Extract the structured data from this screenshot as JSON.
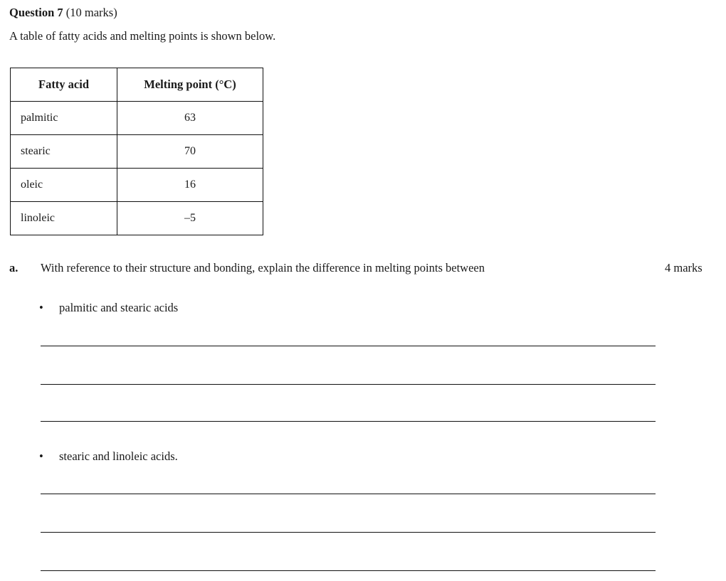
{
  "heading": {
    "question_label": "Question 7",
    "marks": " (10 marks)",
    "intro": "A table of fatty acids and melting points is shown below."
  },
  "table": {
    "headers": [
      "Fatty acid",
      "Melting point (°C)"
    ],
    "rows": [
      {
        "acid": "palmitic",
        "melting_point": "63"
      },
      {
        "acid": "stearic",
        "melting_point": "70"
      },
      {
        "acid": "oleic",
        "melting_point": "16"
      },
      {
        "acid": "linoleic",
        "melting_point": "–5"
      }
    ]
  },
  "parts": [
    {
      "label": "a.",
      "text": "With reference to their structure and bonding, explain the difference in melting points between",
      "marks": "4 marks",
      "bullets": [
        {
          "marker": "•",
          "text": "palmitic and stearic acids"
        },
        {
          "marker": "•",
          "text": "stearic and linoleic acids."
        }
      ]
    }
  ],
  "answer_lines": {
    "group_1": [
      486,
      540,
      592
    ],
    "group_2": [
      694,
      748,
      802
    ]
  },
  "colors": {
    "text": "#1a1a1a",
    "rule": "#111111",
    "background": "#ffffff"
  }
}
